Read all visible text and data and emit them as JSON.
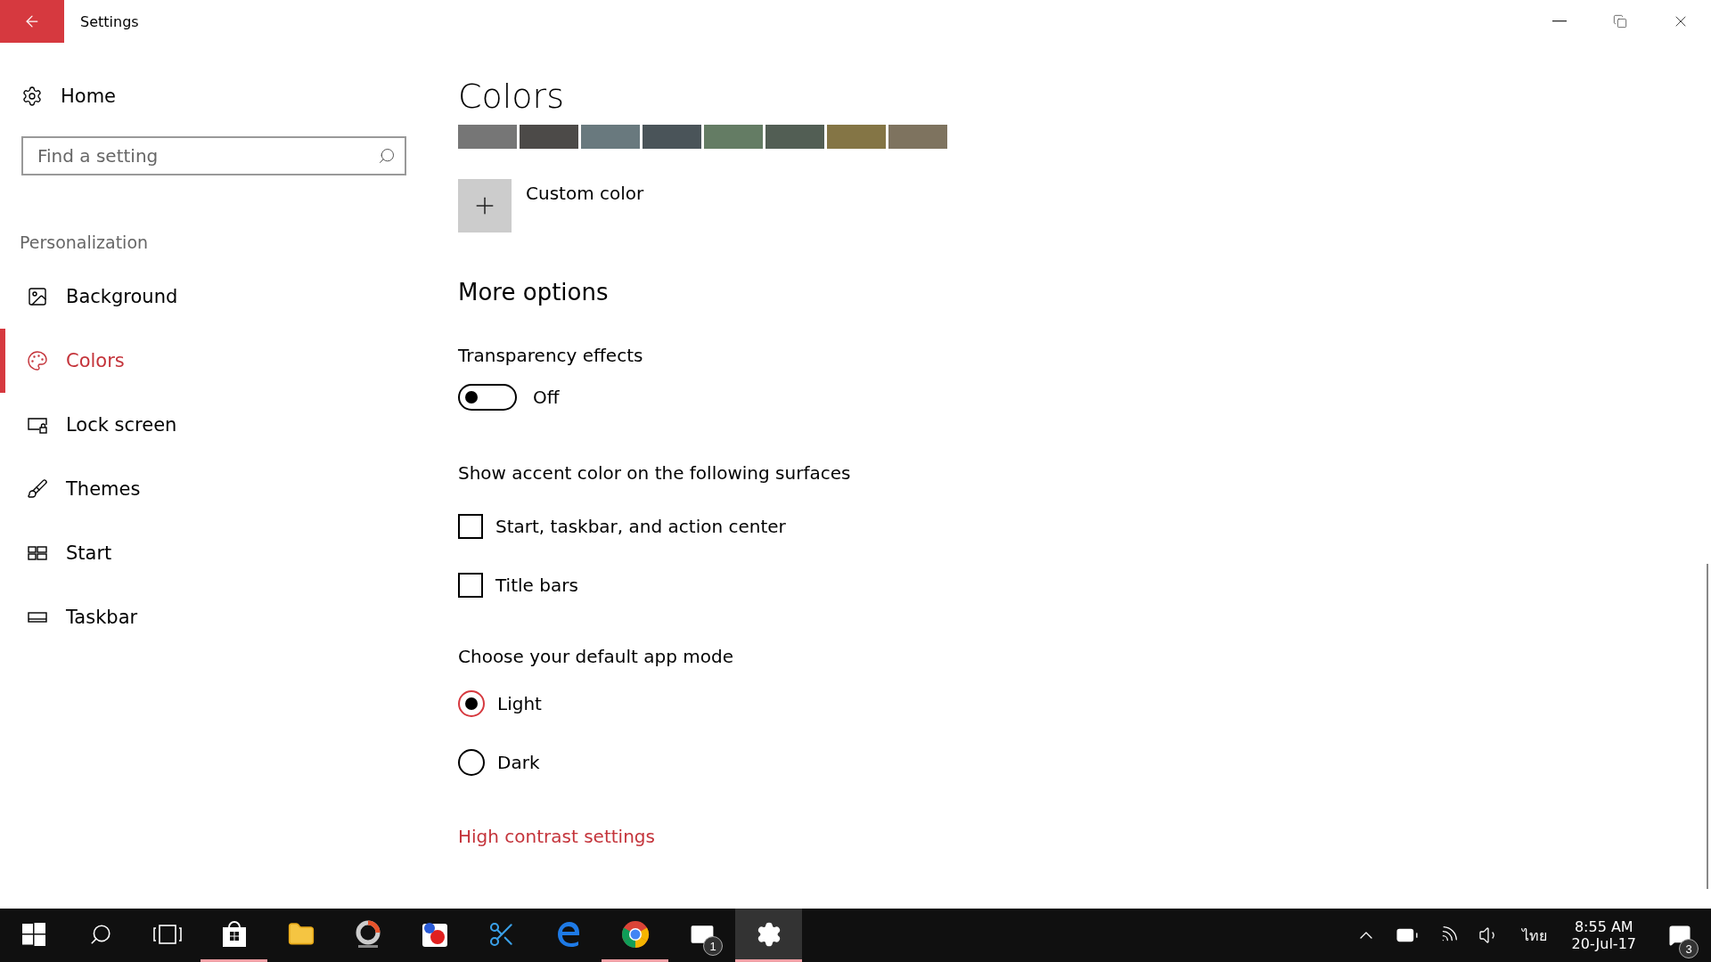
{
  "window": {
    "title": "Settings"
  },
  "sidebar": {
    "home": "Home",
    "search": {
      "placeholder": "Find a setting"
    },
    "section": "Personalization",
    "items": [
      {
        "label": "Background",
        "kind": "background",
        "selected": false
      },
      {
        "label": "Colors",
        "kind": "colors",
        "selected": true
      },
      {
        "label": "Lock screen",
        "kind": "lock",
        "selected": false
      },
      {
        "label": "Themes",
        "kind": "themes",
        "selected": false
      },
      {
        "label": "Start",
        "kind": "start",
        "selected": false
      },
      {
        "label": "Taskbar",
        "kind": "taskbar",
        "selected": false
      }
    ]
  },
  "content": {
    "title": "Colors",
    "swatches": [
      {
        "color": "#767676"
      },
      {
        "color": "#4c4a48"
      },
      {
        "color": "#69797e"
      },
      {
        "color": "#4a5459"
      },
      {
        "color": "#647c64"
      },
      {
        "color": "#525e54"
      },
      {
        "color": "#847545"
      },
      {
        "color": "#7e735f"
      }
    ],
    "custom_color": "Custom color",
    "more_options": "More options",
    "transparency": {
      "label": "Transparency effects",
      "on": false,
      "state": "Off"
    },
    "accent": {
      "label": "Show accent color on the following surfaces",
      "options": [
        {
          "label": "Start, taskbar, and action center",
          "checked": false
        },
        {
          "label": "Title bars",
          "checked": false
        }
      ]
    },
    "mode": {
      "label": "Choose your default app mode",
      "options": [
        {
          "label": "Light",
          "selected": true
        },
        {
          "label": "Dark",
          "selected": false
        }
      ]
    },
    "link": "High contrast settings"
  },
  "taskbar": {
    "apps": [
      {
        "kind": "store",
        "running": true,
        "selected": false
      },
      {
        "kind": "explorer",
        "running": false,
        "selected": false
      },
      {
        "kind": "photoscape",
        "running": false,
        "selected": false
      },
      {
        "kind": "paint",
        "running": false,
        "selected": false
      },
      {
        "kind": "snip",
        "running": false,
        "selected": false
      },
      {
        "kind": "edge",
        "running": false,
        "selected": false
      },
      {
        "kind": "chrome",
        "running": true,
        "selected": false
      },
      {
        "kind": "mail",
        "running": false,
        "selected": false,
        "badge": "1"
      },
      {
        "kind": "settings",
        "running": true,
        "selected": true
      }
    ],
    "tray": {
      "language": "ไทย",
      "time": "8:55 AM",
      "date": "20-Jul-17",
      "notifications": "3"
    }
  }
}
